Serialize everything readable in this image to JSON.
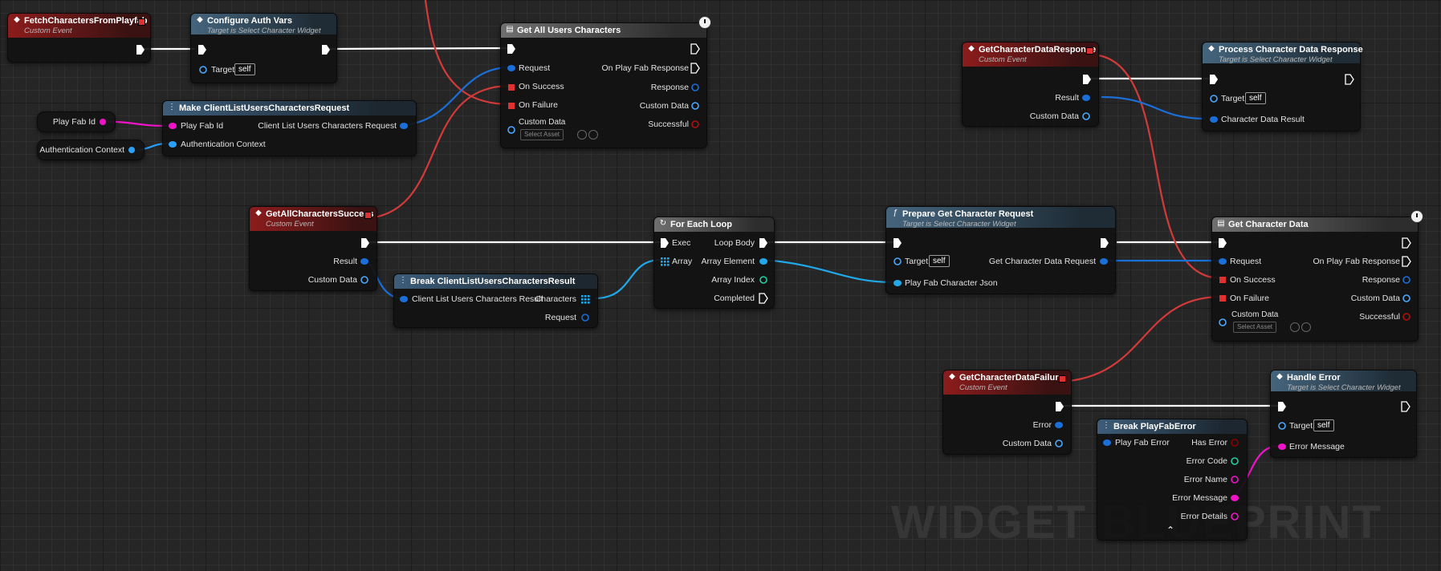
{
  "nodes": {
    "fetch_event": {
      "title": "FetchCharactersFromPlayfab",
      "subtitle": "Custom Event"
    },
    "configure_auth": {
      "title": "Configure Auth Vars",
      "subtitle": "Target is Select Character Widget",
      "target_label": "Target",
      "target_value": "self"
    },
    "get_all_users": {
      "title": "Get All Users Characters",
      "request": "Request",
      "on_success": "On Success",
      "on_failure": "On Failure",
      "custom_data": "Custom Data",
      "select_asset": "Select Asset",
      "on_playfab_response": "On Play Fab Response",
      "response": "Response",
      "custom_data_out": "Custom Data",
      "successful": "Successful"
    },
    "make_request": {
      "title": "Make ClientListUsersCharactersRequest",
      "playfab_id": "Play Fab Id",
      "auth_context": "Authentication Context",
      "output": "Client List Users Characters Request"
    },
    "var_playfab_id": {
      "label": "Play Fab Id"
    },
    "var_auth_context": {
      "label": "Authentication Context"
    },
    "get_all_success": {
      "title": "GetAllCharactersSuccess",
      "subtitle": "Custom Event",
      "result": "Result",
      "custom_data": "Custom Data"
    },
    "break_result": {
      "title": "Break ClientListUsersCharactersResult",
      "input": "Client List Users Characters Result",
      "characters": "Characters",
      "request": "Request"
    },
    "for_each": {
      "title": "For Each Loop",
      "exec": "Exec",
      "array": "Array",
      "loop_body": "Loop Body",
      "array_element": "Array Element",
      "array_index": "Array Index",
      "completed": "Completed"
    },
    "prepare_request": {
      "title": "Prepare Get Character Request",
      "subtitle": "Target is Select Character Widget",
      "target_label": "Target",
      "target_value": "self",
      "json": "Play Fab Character Json",
      "output": "Get Character Data Request"
    },
    "get_char_data": {
      "title": "Get Character Data",
      "request": "Request",
      "on_success": "On Success",
      "on_failure": "On Failure",
      "custom_data": "Custom Data",
      "select_asset": "Select Asset",
      "on_playfab_response": "On Play Fab Response",
      "response": "Response",
      "custom_data_out": "Custom Data",
      "successful": "Successful"
    },
    "char_data_response": {
      "title": "GetCharacterDataResponse",
      "subtitle": "Custom Event",
      "result": "Result",
      "custom_data": "Custom Data"
    },
    "process_response": {
      "title": "Process Character Data Response",
      "subtitle": "Target is Select Character Widget",
      "target_label": "Target",
      "target_value": "self",
      "input": "Character Data Result"
    },
    "char_data_failure": {
      "title": "GetCharacterDataFailure",
      "subtitle": "Custom Event",
      "error": "Error",
      "custom_data": "Custom Data"
    },
    "break_error": {
      "title": "Break PlayFabError",
      "input": "Play Fab Error",
      "has_error": "Has Error",
      "error_code": "Error Code",
      "error_name": "Error Name",
      "error_message": "Error Message",
      "error_details": "Error Details"
    },
    "handle_error": {
      "title": "Handle Error",
      "subtitle": "Target is Select Character Widget",
      "target_label": "Target",
      "target_value": "self",
      "error_message": "Error Message"
    }
  },
  "colors": {
    "exec": "#ffffff",
    "struct": "#1a6fd8",
    "event_delegate": "#e03030",
    "string": "#f014c8",
    "bool": "#8c0000",
    "int": "#20d0a0",
    "wildcard": "#4aa8ff"
  },
  "watermark": "WIDGET BLUEPRINT"
}
